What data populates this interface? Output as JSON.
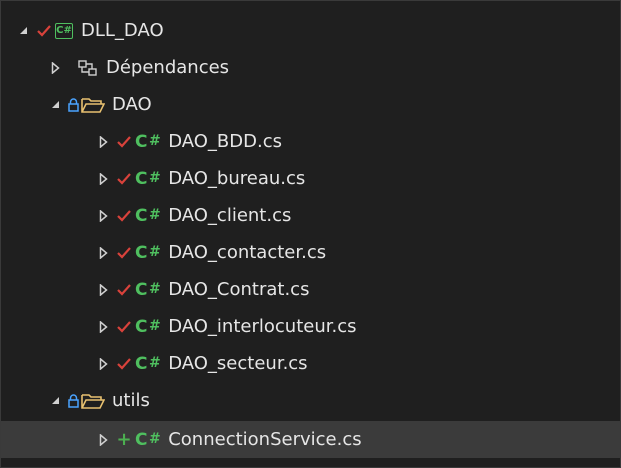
{
  "project": {
    "name": "DLL_DAO",
    "icon": "csharp-project-icon",
    "status": "checked-in"
  },
  "dependencies": {
    "label": "Dépendances",
    "icon": "dependencies-icon"
  },
  "folders": [
    {
      "name": "DAO",
      "icon": "folder-icon",
      "files": [
        {
          "name": "DAO_BDD.cs",
          "status": "checked-in"
        },
        {
          "name": "DAO_bureau.cs",
          "status": "checked-in"
        },
        {
          "name": "DAO_client.cs",
          "status": "checked-in"
        },
        {
          "name": "DAO_contacter.cs",
          "status": "checked-in"
        },
        {
          "name": "DAO_Contrat.cs",
          "status": "checked-in"
        },
        {
          "name": "DAO_interlocuteur.cs",
          "status": "checked-in"
        },
        {
          "name": "DAO_secteur.cs",
          "status": "checked-in"
        }
      ]
    },
    {
      "name": "utils",
      "icon": "folder-icon",
      "files": [
        {
          "name": "ConnectionService.cs",
          "status": "added",
          "selected": true
        }
      ]
    }
  ],
  "glyphs": {
    "csharp": "C",
    "hash": "#",
    "project_badge": "C#",
    "plus": "+"
  },
  "colors": {
    "background": "#1f1f1f",
    "selected_row": "#3b3b3b",
    "text": "#e6e6e6",
    "csharp_green": "#4fbf5f",
    "check_red": "#d9423b",
    "lock_blue": "#4aa3ff",
    "folder_yellow": "#e8c170",
    "added_green": "#4caf50"
  }
}
